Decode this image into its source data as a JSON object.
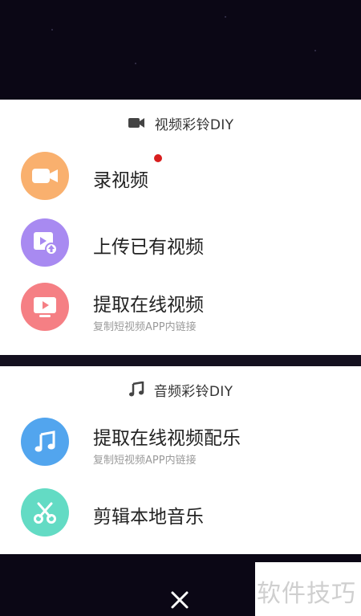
{
  "video_section": {
    "title": "视频彩铃DIY",
    "title_icon": "video-camera-icon",
    "items": [
      {
        "label": "录视频",
        "icon": "video-camera-icon",
        "color": "#f9b06e",
        "badge": "red-dot"
      },
      {
        "label": "上传已有视频",
        "icon": "upload-video-icon",
        "color": "#a88af1"
      },
      {
        "label": "提取在线视频",
        "sublabel": "复制短视频APP内链接",
        "icon": "play-screen-icon",
        "color": "#f57f84"
      }
    ]
  },
  "audio_section": {
    "title": "音频彩铃DIY",
    "title_icon": "music-note-icon",
    "items": [
      {
        "label": "提取在线视频配乐",
        "sublabel": "复制短视频APP内链接",
        "icon": "music-note-icon",
        "color": "#52a5ee"
      },
      {
        "label": "剪辑本地音乐",
        "icon": "scissors-icon",
        "color": "#63dbc4"
      }
    ]
  },
  "close_icon": "close-icon",
  "watermark": "软件技巧",
  "colors": {
    "badge": "#d81e1e",
    "overlay": "#0b0715",
    "panel": "#ffffff"
  }
}
